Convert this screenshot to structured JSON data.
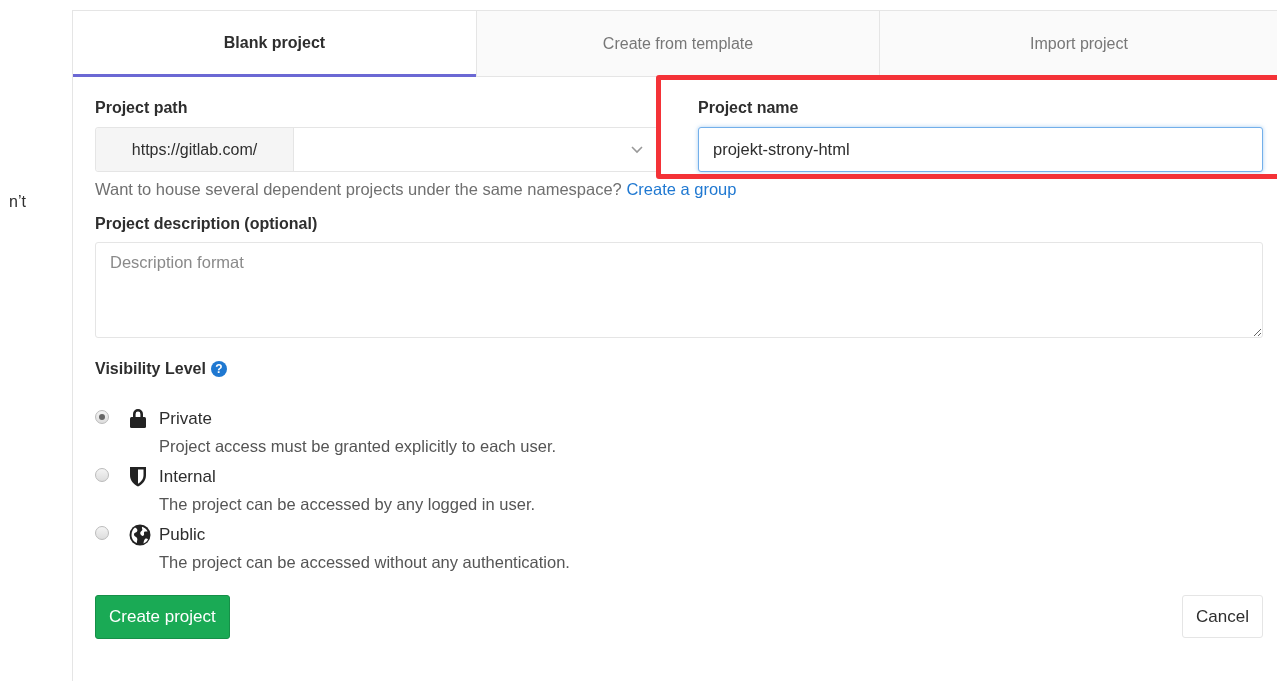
{
  "side_text": "n’t",
  "tabs": [
    {
      "label": "Blank project",
      "selected": true
    },
    {
      "label": "Create from template",
      "selected": false
    },
    {
      "label": "Import project",
      "selected": false
    }
  ],
  "project_path": {
    "label": "Project path",
    "prefix": "https://gitlab.com/"
  },
  "project_name": {
    "label": "Project name",
    "value": "projekt-strony-html",
    "highlighted": true
  },
  "namespace_hint": {
    "text": "Want to house several dependent projects under the same namespace?",
    "link": "Create a group"
  },
  "description": {
    "label": "Project description (optional)",
    "placeholder": "Description format"
  },
  "visibility": {
    "label": "Visibility Level",
    "help": "?",
    "options": [
      {
        "kind": "lock",
        "label": "Private",
        "description": "Project access must be granted explicitly to each user.",
        "selected": true
      },
      {
        "kind": "shield",
        "label": "Internal",
        "description": "The project can be accessed by any logged in user.",
        "selected": false
      },
      {
        "kind": "globe",
        "label": "Public",
        "description": "The project can be accessed without any authentication.",
        "selected": false
      }
    ]
  },
  "buttons": {
    "create": "Create project",
    "cancel": "Cancel"
  }
}
